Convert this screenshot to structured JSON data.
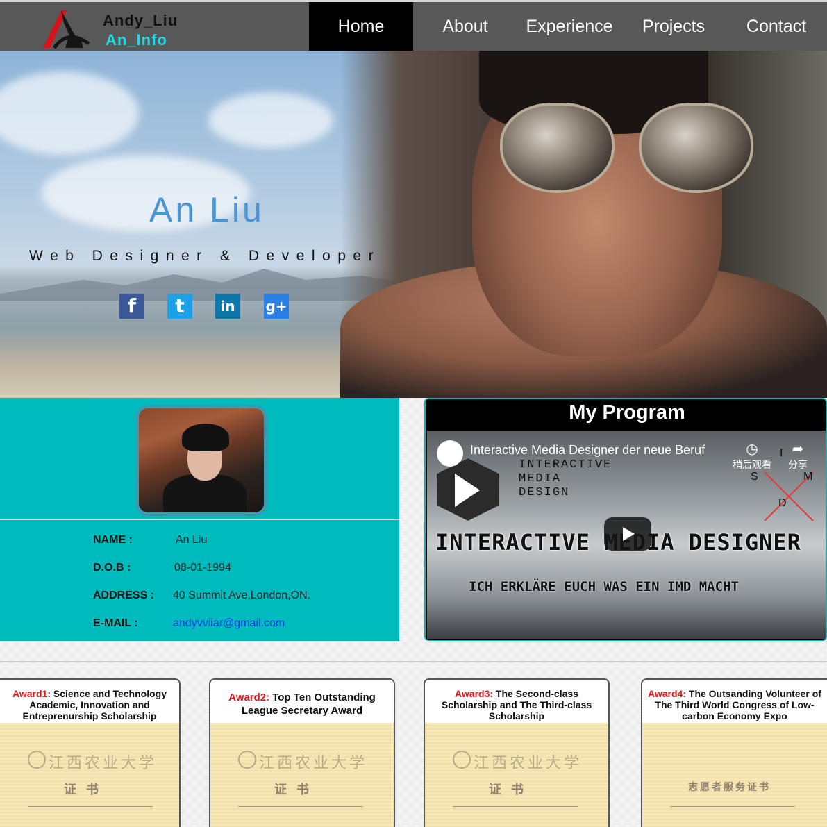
{
  "logo": {
    "line1": "Andy_Liu",
    "line2": "An_Info"
  },
  "nav": {
    "items": [
      "Home",
      "About",
      "Experience",
      "Projects",
      "Contact"
    ],
    "active": "Home"
  },
  "hero": {
    "name": "An Liu",
    "role": "Web Designer & Developer",
    "social": [
      {
        "icon": "facebook-icon",
        "glyph": "f",
        "color": "#3b5998"
      },
      {
        "icon": "twitter-icon",
        "glyph": "t",
        "color": "#1ea0e6"
      },
      {
        "icon": "linkedin-icon",
        "glyph": "in",
        "color": "#0e76a8"
      },
      {
        "icon": "google-plus-icon",
        "glyph": "g+",
        "color": "#2a7fe5"
      }
    ]
  },
  "profile": {
    "rows": [
      {
        "label": "NAME :",
        "value": "An Liu"
      },
      {
        "label": "D.O.B :",
        "value": "08-01-1994"
      },
      {
        "label": "ADDRESS :",
        "value": "40 Summit Ave,London,ON."
      },
      {
        "label": "E-MAIL :",
        "value": "andyvviiar@gmail.com"
      }
    ]
  },
  "program": {
    "title": "My Program",
    "video": {
      "title": "Interactive Media Designer der neue Beruf",
      "subtitle_lines": [
        "INTERACTIVE",
        "MEDIA",
        "DESIGN"
      ],
      "headline": "INTERACTIVE MEDIA DESIGNER",
      "tagline": "ICH ERKLÄRE EUCH WAS EIN IMD MACHT",
      "watch_later": "稍后观看",
      "share": "分享",
      "letters": [
        "I",
        "S",
        "M",
        "D"
      ]
    }
  },
  "awards": [
    {
      "head": "Award1:",
      "text": "Science and Technology Academic, Innovation and Entreprenurship Scholarship"
    },
    {
      "head": "Award2:",
      "text": "Top Ten Outstanding League Secretary Award"
    },
    {
      "head": "Award3:",
      "text": "The Second-class Scholarship and The Third-class Scholarship"
    },
    {
      "head": "Award4:",
      "text": "The Outsanding Volunteer of The Third World Congress of Low-carbon Economy Expo"
    }
  ],
  "colors": {
    "accent": "#00bbbe",
    "nav_bg": "#585858",
    "name_blue": "#4a95d6",
    "award_red": "#e0161a",
    "link_blue": "#0b3be8"
  }
}
